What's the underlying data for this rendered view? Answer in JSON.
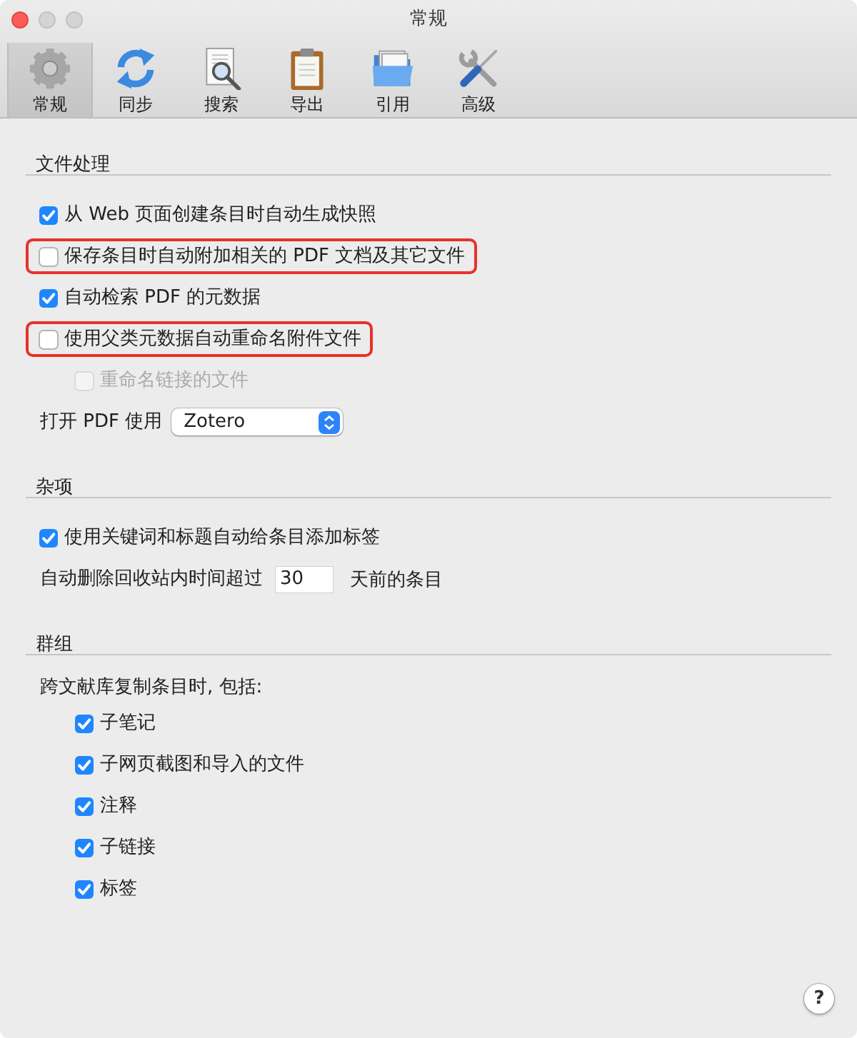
{
  "window": {
    "title": "常规",
    "controls": [
      {
        "kind": "close",
        "disabled": false
      },
      {
        "kind": "minimize",
        "disabled": true
      },
      {
        "kind": "zoom",
        "disabled": true
      }
    ]
  },
  "toolbar": {
    "tabs": [
      {
        "label": "常规",
        "kind": "gear",
        "selected": true
      },
      {
        "label": "同步",
        "kind": "sync",
        "selected": false
      },
      {
        "label": "搜索",
        "kind": "search",
        "selected": false
      },
      {
        "label": "导出",
        "kind": "clipboard",
        "selected": false
      },
      {
        "label": "引用",
        "kind": "folder",
        "selected": false
      },
      {
        "label": "高级",
        "kind": "tools",
        "selected": false
      }
    ]
  },
  "sections": [
    {
      "title": "文件处理",
      "items": [
        {
          "kind": "checkbox",
          "label": "从 Web 页面创建条目时自动生成快照",
          "checked": true,
          "disabled": false,
          "highlighted": false
        },
        {
          "kind": "checkbox",
          "label": "保存条目时自动附加相关的 PDF 文档及其它文件",
          "checked": false,
          "disabled": false,
          "highlighted": true
        },
        {
          "kind": "checkbox",
          "label": "自动检索 PDF 的元数据",
          "checked": true,
          "disabled": false,
          "highlighted": false
        },
        {
          "kind": "checkbox",
          "label": "使用父类元数据自动重命名附件文件",
          "checked": false,
          "disabled": false,
          "highlighted": true,
          "children": [
            {
              "kind": "checkbox",
              "label": "重命名链接的文件",
              "checked": false,
              "disabled": true,
              "highlighted": false
            }
          ]
        },
        {
          "kind": "select",
          "label": "打开 PDF 使用",
          "value": "Zotero"
        }
      ]
    },
    {
      "title": "杂项",
      "items": [
        {
          "kind": "checkbox",
          "label": "使用关键词和标题自动给条目添加标签",
          "checked": true,
          "disabled": false,
          "highlighted": false
        },
        {
          "kind": "number",
          "label": "自动删除回收站内时间超过",
          "value": "30",
          "suffix": "天前的条目"
        }
      ]
    },
    {
      "title": "群组",
      "items": [
        {
          "kind": "text",
          "label": "跨文献库复制条目时, 包括:",
          "children": [
            {
              "kind": "checkbox",
              "label": "子笔记",
              "checked": true,
              "disabled": false,
              "highlighted": false
            },
            {
              "kind": "checkbox",
              "label": "子网页截图和导入的文件",
              "checked": true,
              "disabled": false,
              "highlighted": false
            },
            {
              "kind": "checkbox",
              "label": "注释",
              "checked": true,
              "disabled": false,
              "highlighted": false
            },
            {
              "kind": "checkbox",
              "label": "子链接",
              "checked": true,
              "disabled": false,
              "highlighted": false
            },
            {
              "kind": "checkbox",
              "label": "标签",
              "checked": true,
              "disabled": false,
              "highlighted": false
            }
          ]
        }
      ]
    }
  ],
  "help_button": {
    "label": "?"
  }
}
